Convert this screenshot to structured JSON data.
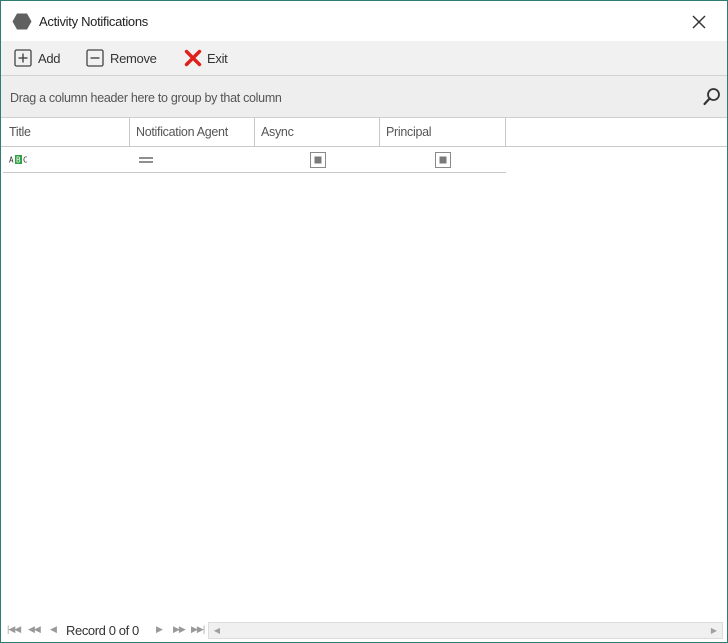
{
  "window": {
    "title": "Activity Notifications"
  },
  "toolbar": {
    "add_label": "Add",
    "remove_label": "Remove",
    "exit_label": "Exit"
  },
  "grid": {
    "group_panel_text": "Drag a column header here to group by that column",
    "columns": [
      "Title",
      "Notification Agent",
      "Async",
      "Principal"
    ],
    "filter_row": {
      "title_icon": "abc-text-filter-icon",
      "agent_icon": "equals-filter-icon",
      "async_icon": "checkbox-filter-icon",
      "principal_icon": "checkbox-filter-icon"
    }
  },
  "footer": {
    "record_text": "Record 0 of 0"
  },
  "colors": {
    "accent_green": "#2f9e44",
    "exit_red": "#e0201b",
    "window_border": "#2f7d72"
  }
}
